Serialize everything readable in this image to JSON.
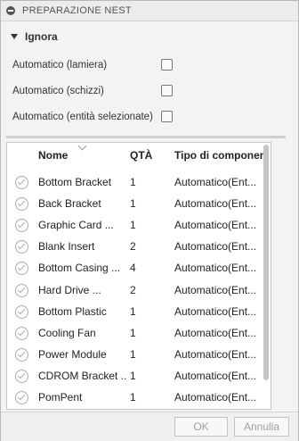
{
  "panel": {
    "title": "PREPARAZIONE NEST",
    "group_title": "Ignora"
  },
  "options": [
    {
      "label": "Automatico (lamiera)",
      "checked": false
    },
    {
      "label": "Automatico (schizzi)",
      "checked": false
    },
    {
      "label": "Automatico (entità selezionate)",
      "checked": false
    }
  ],
  "table": {
    "columns": [
      "Nome",
      "QTÀ",
      "Tipo di componen"
    ],
    "rows": [
      {
        "name": "Bottom Bracket",
        "qty": "1",
        "type": "Automatico(Ent..."
      },
      {
        "name": "Back Bracket",
        "qty": "1",
        "type": "Automatico(Ent..."
      },
      {
        "name": "Graphic Card ...",
        "qty": "1",
        "type": "Automatico(Ent..."
      },
      {
        "name": "Blank Insert",
        "qty": "2",
        "type": "Automatico(Ent..."
      },
      {
        "name": "Bottom Casing ...",
        "qty": "4",
        "type": "Automatico(Ent..."
      },
      {
        "name": "Hard Drive ...",
        "qty": "2",
        "type": "Automatico(Ent..."
      },
      {
        "name": "Bottom Plastic",
        "qty": "1",
        "type": "Automatico(Ent..."
      },
      {
        "name": "Cooling Fan",
        "qty": "1",
        "type": "Automatico(Ent..."
      },
      {
        "name": "Power Module",
        "qty": "1",
        "type": "Automatico(Ent..."
      },
      {
        "name": "CDROM Bracket ...",
        "qty": "1",
        "type": "Automatico(Ent..."
      },
      {
        "name": "PomPent",
        "qty": "1",
        "type": "Automatico(Ent..."
      }
    ]
  },
  "footer": {
    "ok_label": "OK",
    "cancel_label": "Annulla"
  },
  "icons": {
    "title": "collapse-icon",
    "row_status": "check-circle-icon"
  }
}
